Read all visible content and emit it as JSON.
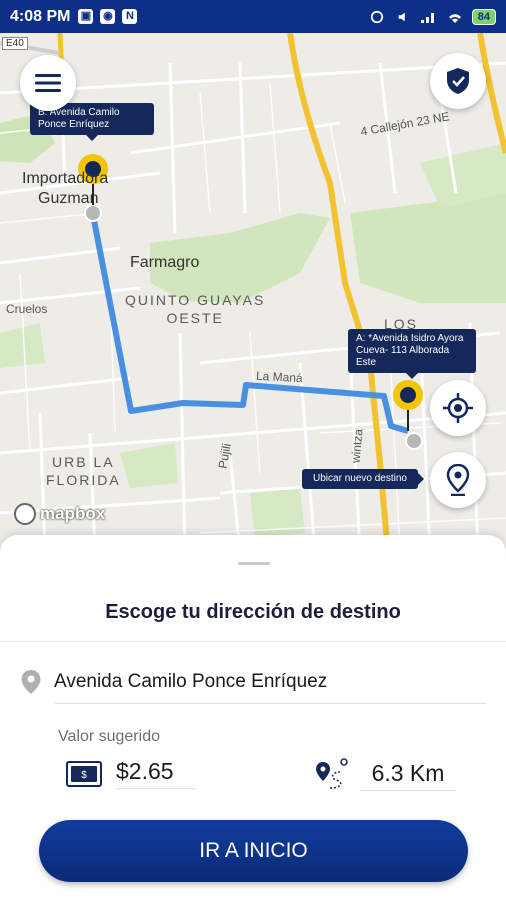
{
  "status_bar": {
    "time": "4:08 PM",
    "battery": "84"
  },
  "map": {
    "road_shield": "E40",
    "labels": {
      "importadora": "Importadora",
      "guzman": "Guzman",
      "farmagro": "Farmagro",
      "quinto_guayas_1": "QUINTO GUAYAS",
      "quinto_guayas_2": "OESTE",
      "cruelos": "Cruelos",
      "callejon": "4 Callejón 23 NE",
      "los": "LOS",
      "la_mana": "La Maná",
      "pujili": "Pujili",
      "wintza": "wintza",
      "urb_1": "URB LA",
      "urb_2": "FLORIDA"
    },
    "origin_tooltip": "B: Avenida Camilo Ponce Enríquez",
    "destination_tooltip": "A: *Avenida Isidro Ayora Cueva- 113 Alborada Este",
    "locate_tooltip": "Ubicar nuevo destino",
    "attribution": "mapbox",
    "colors": {
      "route": "#4a90e2",
      "pin_yellow": "#f5c400",
      "pin_dark": "#14285a"
    }
  },
  "sheet": {
    "title": "Escoge tu dirección de destino",
    "address": "Avenida Camilo Ponce Enríquez",
    "valor_label": "Valor sugerido",
    "price": "$2.65",
    "distance": "6.3 Km",
    "cta": "IR A INICIO"
  },
  "icons": {
    "menu": "menu-icon",
    "shield": "shield-icon",
    "target": "crosshair-icon",
    "pin": "location-pin-icon",
    "money": "cash-icon",
    "route": "route-icon"
  }
}
